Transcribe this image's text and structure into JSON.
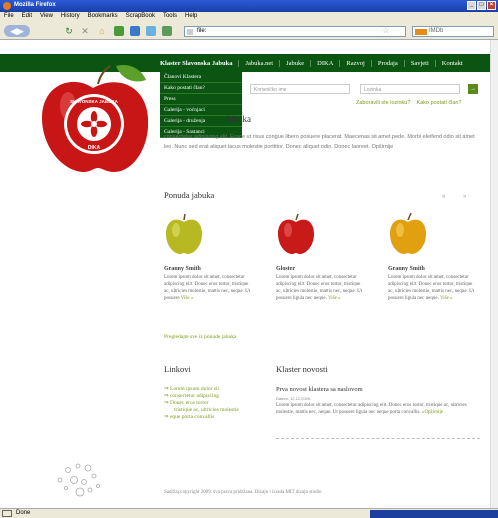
{
  "window": {
    "title": "Mozilla Firefox"
  },
  "menu": [
    "File",
    "Edit",
    "View",
    "History",
    "Bookmarks",
    "ScrapBook",
    "Tools",
    "Help"
  ],
  "toolbar": {
    "url": "file:",
    "search_placeholder": "IMDb"
  },
  "nav": {
    "items": [
      "Klaster Slavonska Jabuka",
      "Jabuka.net",
      "Jabuke",
      "DIKA",
      "Razvoj",
      "Prodaja",
      "Savjeti",
      "Kontakt"
    ],
    "dropdown": [
      "Članovi Klastera",
      "Kako postati član?",
      "Press",
      "Galerija - voćnjaci",
      "Galerija - druženja",
      "Galerija - Sastanci"
    ]
  },
  "logo": {
    "text_top": "SLAVONSKA JABUKA",
    "text_bottom": "DIKA"
  },
  "login": {
    "username_placeholder": "Korisničko ime",
    "password_placeholder": "Lozinka",
    "go_label": "→",
    "forgot_link": "Zaboravili ste lozinku?",
    "join_link": "Kako postati član?"
  },
  "intro": {
    "title": "Jabuka",
    "text": "consectetur adipiscing elit. Fusce ut risus congue libero posuere placerat. Maecenas sit amet pede. Morbi eleifend odio sit amet leo. Nunc sed erat aliquet lacus molestie porttitor. Donec aliquet odio. Donec laoreet. Opširnije"
  },
  "offer": {
    "title": "Ponuda jabuka",
    "arrows": "« »",
    "items": [
      {
        "name": "Granny Smith",
        "desc": "Lorem ipsum dolor sit amet, consectetur adipiscing elit. Donec eros tortor, tristique ac, ultricies molestie, mattis nec, neque. Ut posuere",
        "more": "Više »",
        "color": "#b8b822"
      },
      {
        "name": "Gloster",
        "desc": "Lorem ipsum dolor sit amet, consectetur adipiscing elit. Donec eros tortor, tristique ac, ultricies molestie, mattis nec, neque. Ut posuere ligula nec neque.",
        "more": "Više »",
        "color": "#c81a18"
      },
      {
        "name": "Granny Smith",
        "desc": "Lorem ipsum dolor sit amet, consectetur adipiscing elit. Donec eros tortor, tristique ac, ultricies molestie, mattis nec, neque. Ut posuere ligula nec neque.",
        "more": "Više »",
        "color": "#e0a010"
      }
    ],
    "all_link": "Pregledajte sve iz ponude jabuka"
  },
  "links": {
    "title": "Linkovi",
    "items": [
      "Lorem ipsum dolor sit",
      "consectetur adipiscing",
      "Donec eros tortor",
      "tristique ac, ultricies molestie",
      "eque porta convallis"
    ]
  },
  "news": {
    "title": "Klaster novosti",
    "headline": "Prva novost klastera sa naslovom",
    "date": "Datum: 12.12.2009.",
    "body": "Lorem ipsum dolor sit amet, consectetur adipiscing elit. Donec eros tortor, tristique ac, ultricies molestie, mattis nec, neque. Ut posuere ligula nec neque porta convallis.",
    "more": "»Opširnije"
  },
  "footer": {
    "copyright": "Sadržaj copyright 2009. sva prava pridržana. Dizajn i izrada MIT dizajn studio"
  },
  "status": {
    "text": "Done"
  },
  "colors": {
    "nav_green": "#0a5512",
    "link_green": "#7a9a1a"
  }
}
